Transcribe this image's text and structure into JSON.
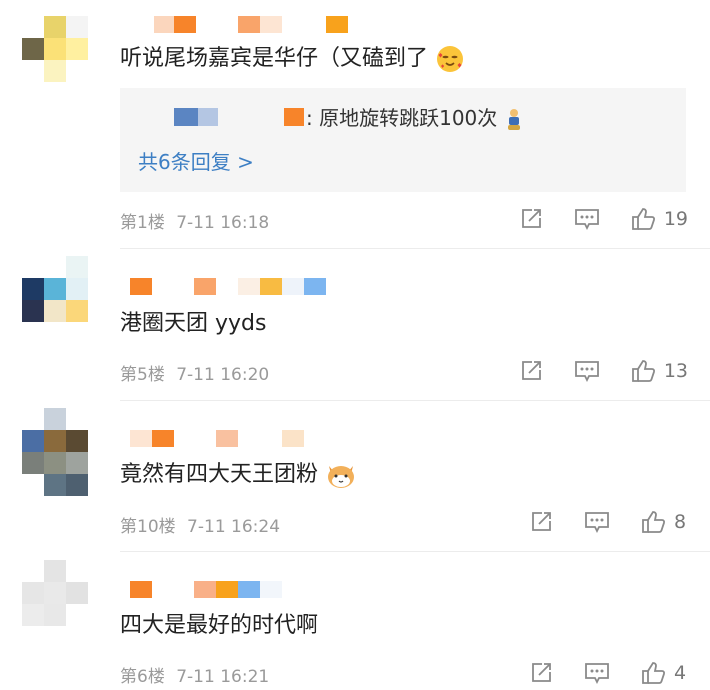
{
  "comments": [
    {
      "text": "听说尾场嘉宾是华仔（又磕到了",
      "emoji": "face-with-hearts-emoji",
      "floor": "第1楼",
      "time": "7-11 16:18",
      "likes": "19",
      "reply": {
        "text": ": 原地旋转跳跃100次",
        "emoji": "dancing-figure-emoji",
        "more": "共6条回复 >"
      }
    },
    {
      "text": "港圈天团 yyds",
      "floor": "第5楼",
      "time": "7-11 16:20",
      "likes": "13"
    },
    {
      "text": "竟然有四大天王团粉",
      "emoji": "cat-face-emoji",
      "floor": "第10楼",
      "time": "7-11 16:24",
      "likes": "8"
    },
    {
      "text": "四大是最好的时代啊",
      "floor": "第6楼",
      "time": "7-11 16:21",
      "likes": "4"
    }
  ],
  "icons": {
    "share": "share-icon",
    "comment": "comment-icon",
    "like": "thumbs-up-icon"
  },
  "colors": {
    "link": "#3d7fc4",
    "meta": "#9a9a9a",
    "reply_bg": "#f5f5f5",
    "mosaic_orange": "#f7842a"
  }
}
